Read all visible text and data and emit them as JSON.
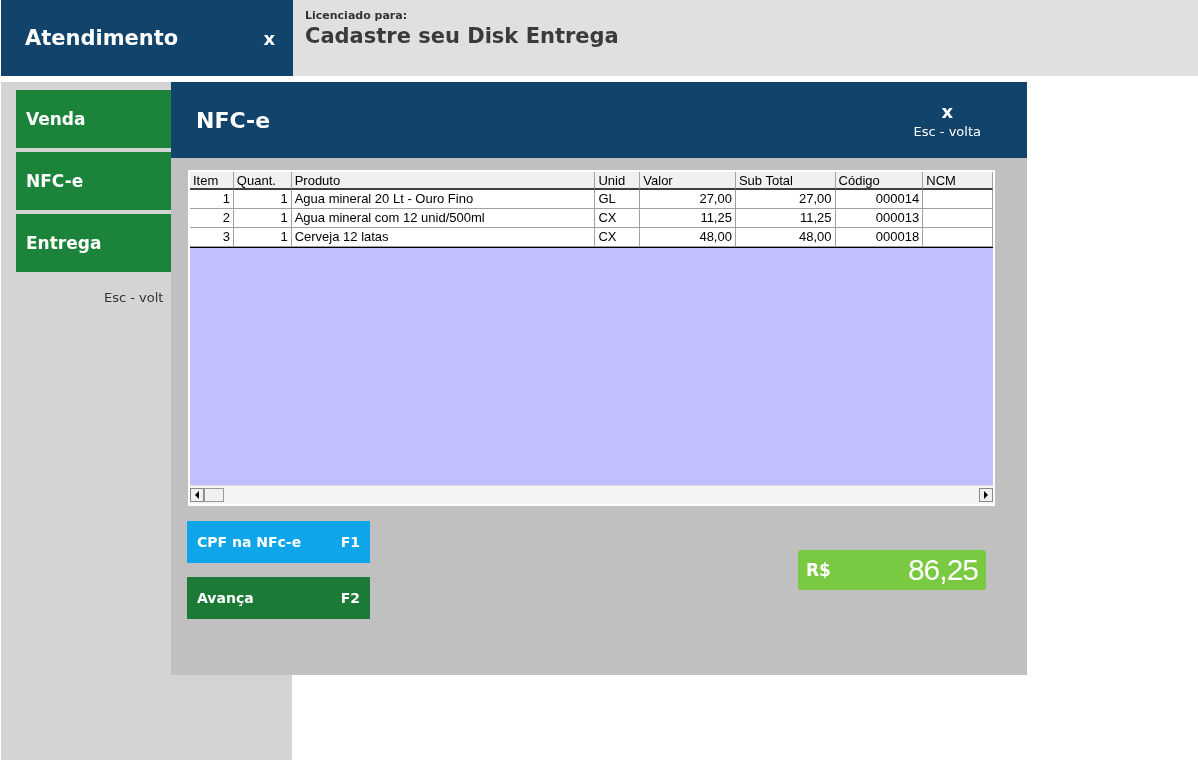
{
  "header": {
    "title": "Atendimento",
    "close": "x",
    "license_label": "Licenciado para:",
    "license_name": "Cadastre seu Disk Entrega"
  },
  "sidebar": {
    "items": [
      {
        "label": "Venda"
      },
      {
        "label": "NFC-e"
      },
      {
        "label": "Entrega"
      }
    ],
    "hint": "Esc - volt"
  },
  "dialog": {
    "title": "NFC-e",
    "close": "x",
    "close_hint": "Esc - volta",
    "table": {
      "columns": [
        {
          "label": "Item",
          "kind": "number"
        },
        {
          "label": "Quant.",
          "kind": "number"
        },
        {
          "label": "Produto",
          "kind": "text"
        },
        {
          "label": "Unid",
          "kind": "text"
        },
        {
          "label": "Valor",
          "kind": "number"
        },
        {
          "label": "Sub Total",
          "kind": "number"
        },
        {
          "label": "Código",
          "kind": "number"
        },
        {
          "label": "NCM",
          "kind": "text"
        }
      ],
      "rows": [
        [
          "1",
          "1",
          "Agua mineral 20 Lt - Ouro Fino",
          "GL",
          "27,00",
          "27,00",
          "000014",
          ""
        ],
        [
          "2",
          "1",
          "Agua mineral com 12 unid/500ml",
          "CX",
          "11,25",
          "11,25",
          "000013",
          ""
        ],
        [
          "3",
          "1",
          "Cerveja 12 latas",
          "CX",
          "48,00",
          "48,00",
          "000018",
          ""
        ]
      ]
    },
    "buttons": [
      {
        "label": "CPF na NFc-e",
        "key": "F1",
        "color": "#0ea5e9"
      },
      {
        "label": "Avança",
        "key": "F2",
        "color": "#1a7a36"
      }
    ],
    "total": {
      "currency": "R$",
      "value": "86,25"
    }
  }
}
